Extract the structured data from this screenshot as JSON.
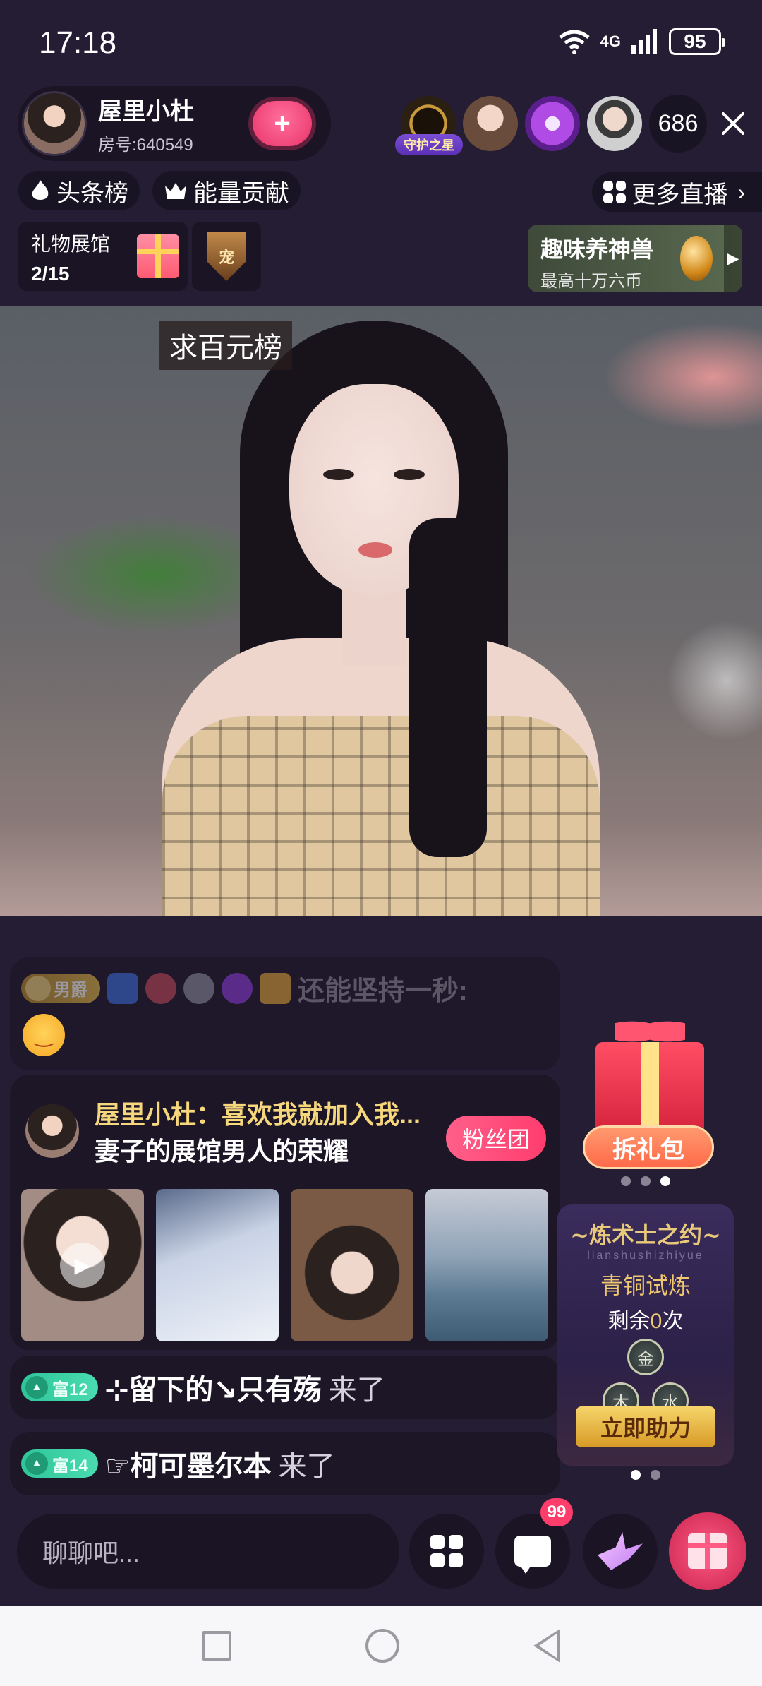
{
  "status_bar": {
    "time": "17:18",
    "network": "4G",
    "battery": "95",
    "icons": [
      "wifi-icon",
      "signal-icon",
      "battery-icon"
    ]
  },
  "host": {
    "name": "屋里小杜",
    "room": "房号:640549",
    "follow_icon": "heart-plus-icon"
  },
  "viewers": {
    "guard_label": "守护之星",
    "count": "686",
    "close_icon": "close-icon"
  },
  "ranks": {
    "hot": "头条榜",
    "energy": "能量贡献",
    "more_live": "更多直播"
  },
  "gift_hall": {
    "title": "礼物展馆",
    "progress": "2/15",
    "pet_badge": "宠"
  },
  "beast_banner": {
    "title": "趣味养神兽",
    "subtitle": "最高十万六币"
  },
  "video": {
    "caption": "求百元榜"
  },
  "chat": {
    "faded_badge": "男爵",
    "faded_text": "还能坚持一秒:",
    "share": {
      "title": "屋里小杜：喜欢我就加入我...",
      "subtitle": "妻子的展馆男人的荣耀",
      "fan_button": "粉丝团"
    },
    "entries": [
      {
        "badge": "富12",
        "name": "⊹留下的↘只有殇",
        "suffix": "来了"
      },
      {
        "badge": "富14",
        "name": "☞柯可墨尔本",
        "suffix": "来了"
      }
    ]
  },
  "side": {
    "unpack_button": "拆礼包",
    "alchemy": {
      "title": "~炼术士之约~",
      "subtitle": "lianshushizhiyue",
      "level": "青铜试炼",
      "remain_prefix": "剩余",
      "remain_count": "0",
      "remain_suffix": "次",
      "runes": [
        "金",
        "木",
        "水"
      ],
      "assist_button": "立即助力"
    }
  },
  "bottom_bar": {
    "input_placeholder": "聊聊吧...",
    "msg_badge": "99"
  }
}
